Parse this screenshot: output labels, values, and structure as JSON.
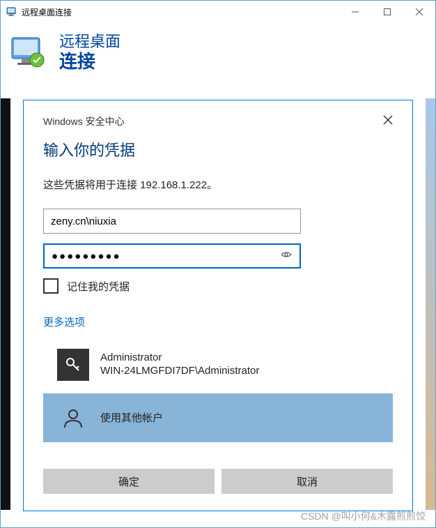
{
  "window": {
    "title": "远程桌面连接"
  },
  "banner": {
    "line1": "远程桌面",
    "line2": "连接"
  },
  "security": {
    "header": "Windows 安全中心",
    "heading": "输入你的凭据",
    "desc": "这些凭据将用于连接 192.168.1.222。",
    "username_value": "zeny.cn\\niuxia",
    "password_value": "●●●●●●●●●",
    "remember_label": "记住我的凭据",
    "more_options": "更多选项",
    "account1": {
      "name": "Administrator",
      "sub": "WIN-24LMGFDI7DF\\Administrator"
    },
    "account2": {
      "label": "使用其他帐户"
    },
    "ok": "确定",
    "cancel": "取消"
  },
  "watermark": "CSDN @叫小何&木露煎煎饺"
}
